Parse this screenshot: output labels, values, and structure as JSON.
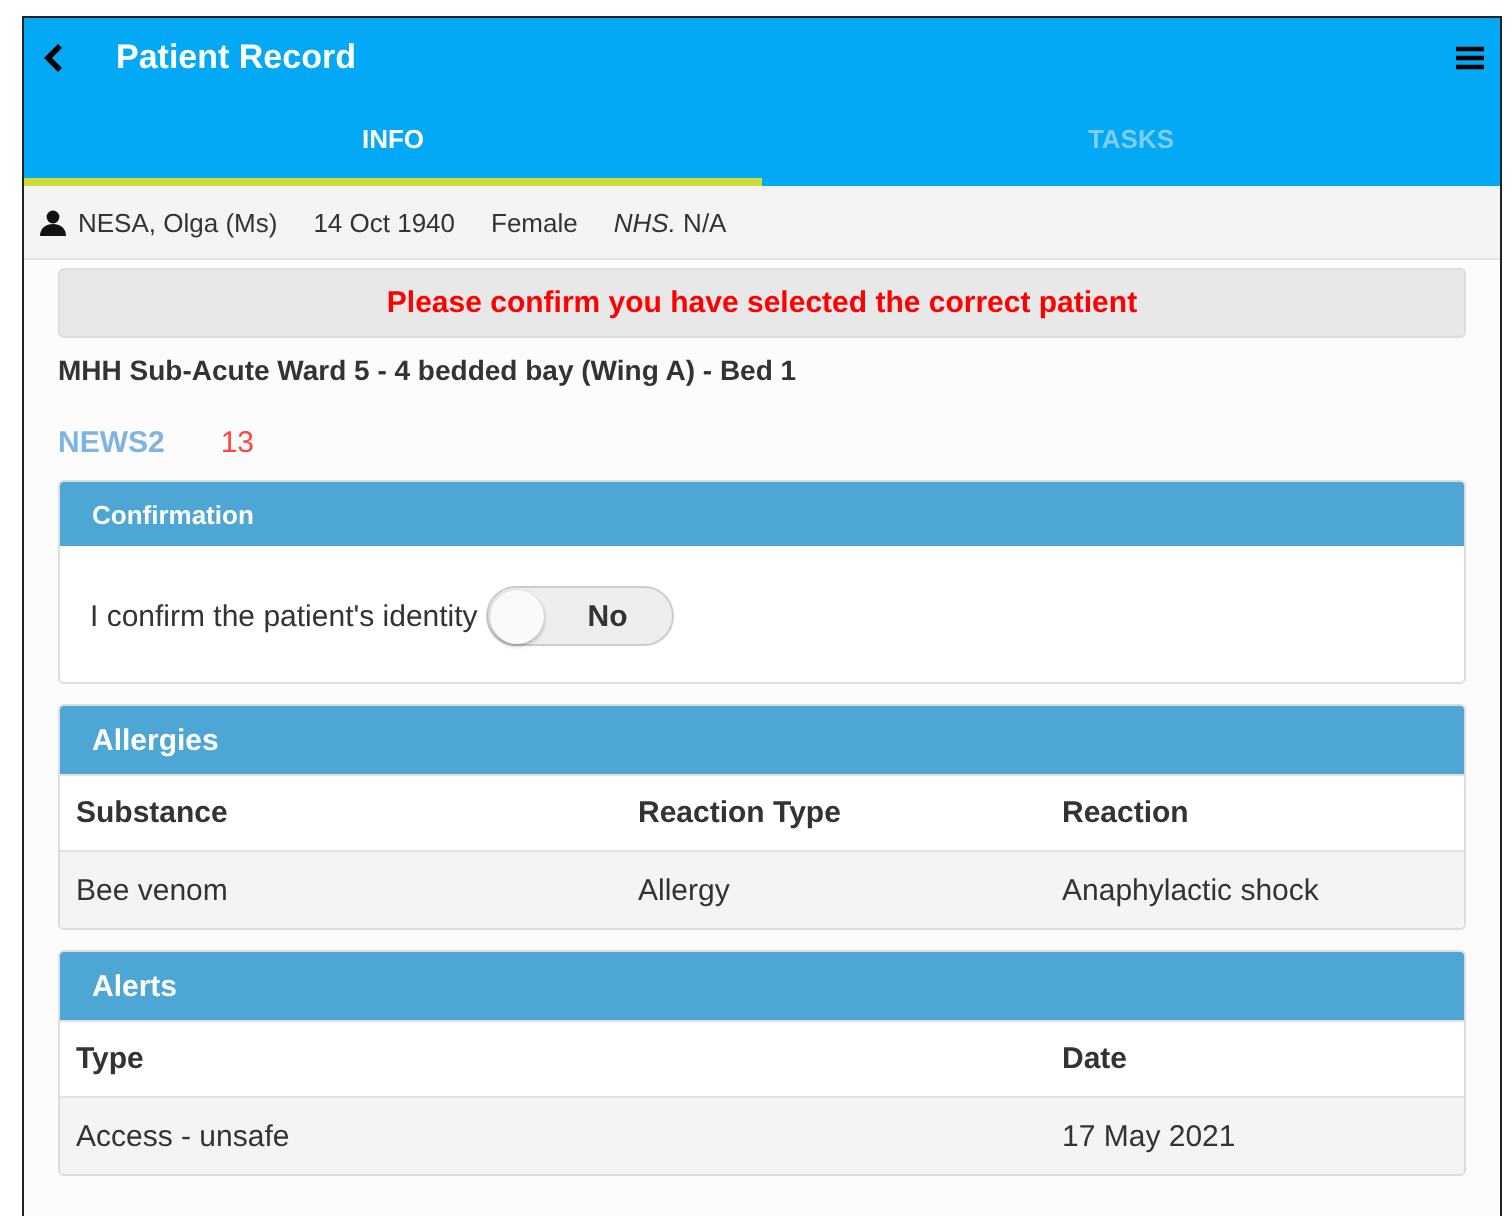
{
  "header": {
    "title": "Patient Record"
  },
  "tabs": [
    {
      "label": "INFO",
      "selected": true
    },
    {
      "label": "TASKS",
      "selected": false
    }
  ],
  "patient": {
    "name": "NESA, Olga (Ms)",
    "dob": "14 Oct 1940",
    "sex": "Female",
    "nhs": "*NHS.* N/A"
  },
  "warning": "Please confirm you have selected the correct patient",
  "location": "MHH Sub-Acute Ward 5 - 4 bedded bay (Wing A) - Bed 1",
  "news2": {
    "label": "NEWS2",
    "score": "13"
  },
  "confirmation": {
    "title": "Confirmation",
    "label": "I confirm the patient's identity",
    "toggle": {
      "on": false,
      "text": "No"
    }
  },
  "allergies": {
    "title": "Allergies",
    "columns": [
      "Substance",
      "Reaction Type",
      "Reaction"
    ],
    "rows": [
      [
        "Bee venom",
        "Allergy",
        "Anaphylactic shock"
      ]
    ]
  },
  "alerts": {
    "title": "Alerts",
    "columns": [
      "Type",
      "Date"
    ],
    "rows": [
      [
        "Access - unsafe",
        "17 May 2021"
      ]
    ]
  }
}
